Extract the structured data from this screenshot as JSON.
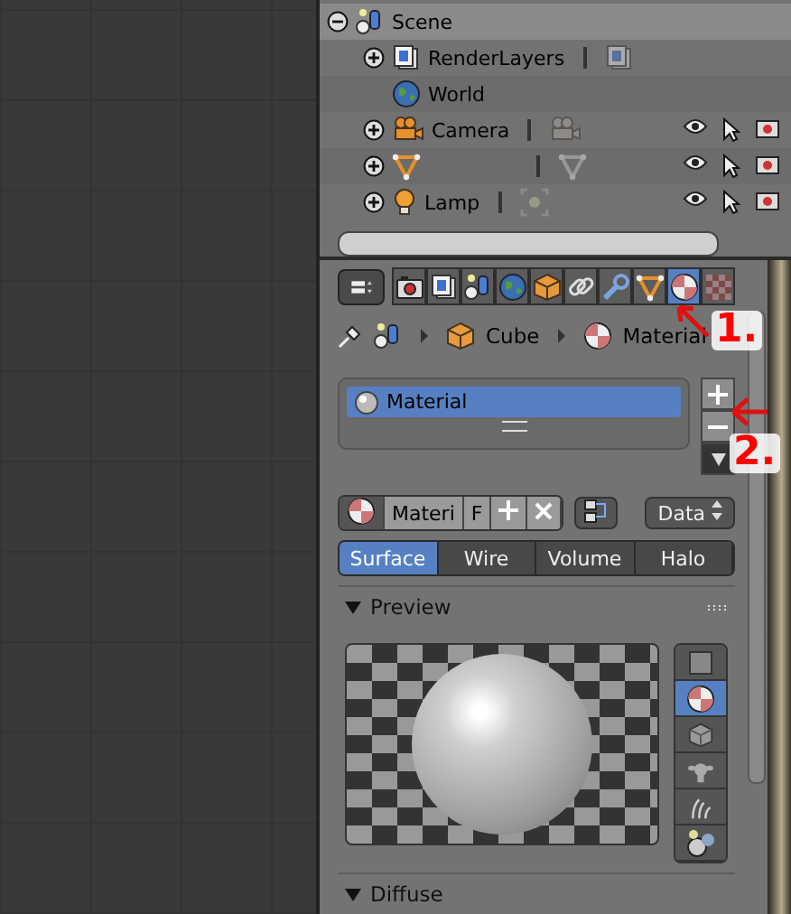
{
  "outliner": {
    "items": [
      {
        "name": "Scene",
        "kind": "scene",
        "expanded": true,
        "children": [
          {
            "name": "RenderLayers",
            "kind": "renderlayers",
            "expanded": false,
            "linked_data": true,
            "restrict": false
          },
          {
            "name": "World",
            "kind": "world",
            "linked_data": false,
            "restrict": false
          },
          {
            "name": "Camera",
            "kind": "camera",
            "expanded": false,
            "linked_data": true,
            "restrict": true
          },
          {
            "kind": "mesh",
            "expanded": false,
            "linked_data": true,
            "restrict": true
          },
          {
            "name": "Lamp",
            "kind": "lamp",
            "expanded": false,
            "linked_data": true,
            "restrict": true
          }
        ]
      }
    ]
  },
  "properties": {
    "tabs": [
      {
        "kind": "render",
        "selected": false
      },
      {
        "kind": "layers",
        "selected": false
      },
      {
        "kind": "scene",
        "selected": false
      },
      {
        "kind": "world",
        "selected": false
      },
      {
        "kind": "object",
        "selected": false
      },
      {
        "kind": "constraints",
        "selected": false
      },
      {
        "kind": "modifiers",
        "selected": false
      },
      {
        "kind": "data",
        "selected": false
      },
      {
        "kind": "material",
        "selected": true
      },
      {
        "kind": "texture",
        "selected": false
      }
    ],
    "breadcrumb": [
      "Cube",
      "Material"
    ],
    "material_slots": [
      {
        "name": "Material",
        "selected": true
      }
    ],
    "datablock": {
      "name": "Materi",
      "fake_user": "F",
      "link": "Data"
    },
    "type_tabs": [
      {
        "label": "Surface",
        "selected": true
      },
      {
        "label": "Wire",
        "selected": false
      },
      {
        "label": "Volume",
        "selected": false
      },
      {
        "label": "Halo",
        "selected": false
      }
    ],
    "panels": [
      {
        "title": "Preview",
        "expanded": true,
        "preview_shapes": [
          {
            "kind": "plane",
            "selected": false
          },
          {
            "kind": "sphere",
            "selected": true
          },
          {
            "kind": "cube",
            "selected": false
          },
          {
            "kind": "monkey",
            "selected": false
          },
          {
            "kind": "hair",
            "selected": false
          },
          {
            "kind": "sky",
            "selected": false
          }
        ]
      },
      {
        "title": "Diffuse",
        "expanded": true
      }
    ]
  },
  "annotations": [
    "1.",
    "2."
  ]
}
